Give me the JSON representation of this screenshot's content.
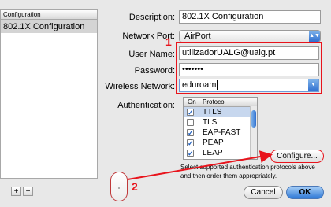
{
  "sidebar": {
    "header": "Configuration",
    "items": [
      {
        "label": "802.1X Configuration"
      }
    ],
    "add_label": "+",
    "remove_label": "−"
  },
  "form": {
    "description_label": "Description:",
    "description_value": "802.1X Configuration",
    "network_port_label": "Network Port:",
    "network_port_value": "AirPort",
    "user_name_label": "User Name:",
    "user_name_value": "utilizadorUALG@ualg.pt",
    "password_label": "Password:",
    "password_value": "•••••••",
    "wireless_network_label": "Wireless Network:",
    "wireless_network_value": "eduroam",
    "authentication_label": "Authentication:"
  },
  "auth_table": {
    "col_on": "On",
    "col_protocol": "Protocol",
    "rows": [
      {
        "name": "TTLS",
        "on": true
      },
      {
        "name": "TLS",
        "on": false
      },
      {
        "name": "EAP-FAST",
        "on": true
      },
      {
        "name": "PEAP",
        "on": true
      },
      {
        "name": "LEAP",
        "on": true
      }
    ]
  },
  "buttons": {
    "configure": "Configure...",
    "cancel": "Cancel",
    "ok": "OK"
  },
  "hint": "Select supported authentication protocols above and then order them appropriately.",
  "annotations": {
    "step1": "1",
    "step2": "2"
  },
  "colors": {
    "annotation": "#e8141c",
    "accent": "#2f6fcf"
  }
}
